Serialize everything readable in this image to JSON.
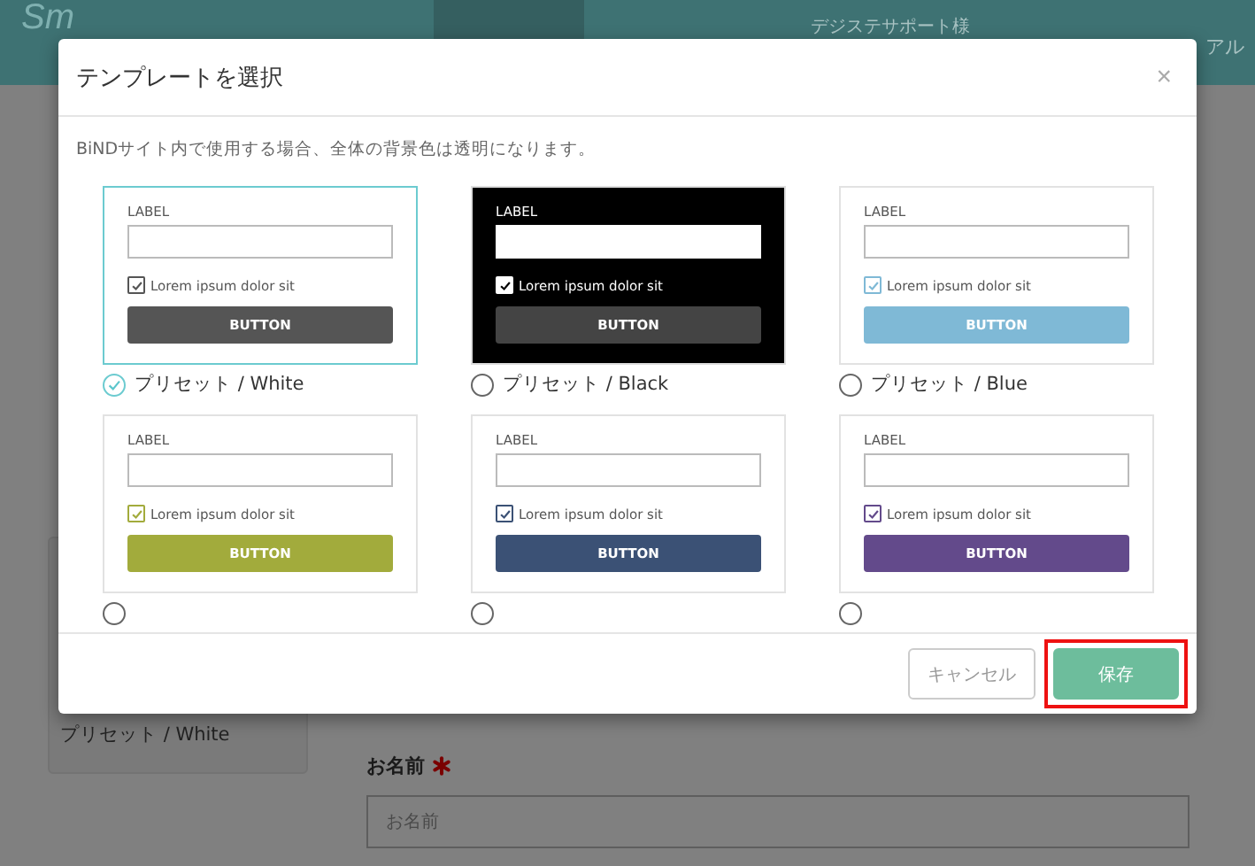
{
  "header": {
    "logo": "Sm",
    "account": "デジステサポート様",
    "manual": "アル"
  },
  "page": {
    "preset_label": "プリセット / White",
    "field_label": "お名前",
    "required": true,
    "field_placeholder": "お名前"
  },
  "modal": {
    "title": "テンプレートを選択",
    "close": "×",
    "note": "BiNDサイト内で使用する場合、全体の背景色は透明になります。",
    "presets": [
      {
        "kind": "light",
        "color": "#555555",
        "label": "プリセット / White",
        "selected": true,
        "preview": {
          "field_label": "LABEL",
          "checkbox_label": "Lorem ipsum dolor sit",
          "checked": true,
          "button": "BUTTON"
        }
      },
      {
        "kind": "dark",
        "color": "#444444",
        "label": "プリセット / Black",
        "selected": false,
        "preview": {
          "field_label": "LABEL",
          "checkbox_label": "Lorem ipsum dolor sit",
          "checked": true,
          "button": "BUTTON"
        }
      },
      {
        "kind": "light",
        "color": "#7fb9d6",
        "label": "プリセット / Blue",
        "selected": false,
        "preview": {
          "field_label": "LABEL",
          "checkbox_label": "Lorem ipsum dolor sit",
          "checked": true,
          "button": "BUTTON"
        }
      },
      {
        "kind": "light",
        "color": "#a2ab3c",
        "selected": false,
        "preview": {
          "field_label": "LABEL",
          "checkbox_label": "Lorem ipsum dolor sit",
          "checked": true,
          "button": "BUTTON"
        }
      },
      {
        "kind": "light",
        "color": "#3b5175",
        "selected": false,
        "preview": {
          "field_label": "LABEL",
          "checkbox_label": "Lorem ipsum dolor sit",
          "checked": true,
          "button": "BUTTON"
        }
      },
      {
        "kind": "light",
        "color": "#634a8b",
        "selected": false,
        "preview": {
          "field_label": "LABEL",
          "checkbox_label": "Lorem ipsum dolor sit",
          "checked": true,
          "button": "BUTTON"
        }
      }
    ],
    "buttons": [
      {
        "label": "キャンセル",
        "kind": "secondary",
        "highlighted": false
      },
      {
        "label": "保存",
        "kind": "primary",
        "highlighted": true
      }
    ]
  }
}
